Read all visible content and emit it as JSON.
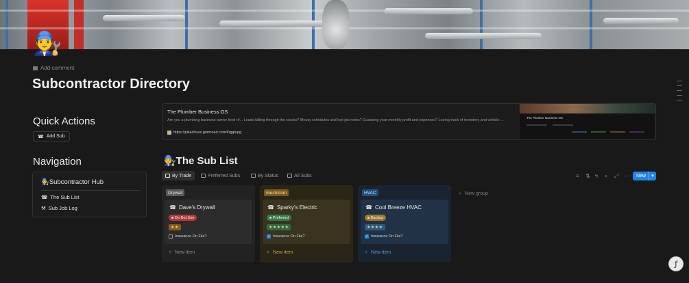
{
  "page": {
    "avatar_emoji": "🧑‍🔧",
    "add_comment": "Add comment",
    "title": "Subcontractor Directory"
  },
  "quick_actions": {
    "heading": "Quick Actions",
    "add_sub_label": "Add Sub"
  },
  "navigation": {
    "heading": "Navigation",
    "hub_title": "🧑‍🔧Subcontractor Hub",
    "links": [
      {
        "icon": "☎",
        "label": "The Sub List"
      },
      {
        "icon": "⚒",
        "label": "Sub Job Log"
      }
    ]
  },
  "bookmark": {
    "title": "The Plumber Business OS",
    "description": "Are you a plumbing business owner tired of... Leads falling through the cracks? Messy schedules and lost job notes? Guessing your monthly profit and expenses? Losing track of inventory and vehicle ...",
    "url": "https://pikachuux.gumroad.com/l/qgpupg",
    "thumb_title": "The Plumber Business OS"
  },
  "sub_list": {
    "title": "🧑‍🔧The Sub List",
    "tabs": [
      {
        "label": "By Trade",
        "active": true
      },
      {
        "label": "Preferred Subs",
        "active": false
      },
      {
        "label": "By Status",
        "active": false
      },
      {
        "label": "All Subs",
        "active": false
      }
    ],
    "new_button": "New",
    "new_group": "New group",
    "columns": [
      {
        "badge": "Drywall",
        "card_title": "Dave's Drywall",
        "status": "Do Not Use",
        "stars": "★★",
        "insurance_label": "Insurance On File?",
        "insurance_checked": false,
        "new_item": "New item"
      },
      {
        "badge": "Electrician",
        "card_title": "Sparky's Electric",
        "status": "Preferred",
        "stars": "★★★★★",
        "insurance_label": "Insurance On File?",
        "insurance_checked": true,
        "new_item": "New item"
      },
      {
        "badge": "HVAC",
        "card_title": "Cool Breeze HVAC",
        "status": "Backup",
        "stars": "★★★★",
        "insurance_label": "Insurance On File?",
        "insurance_checked": true,
        "new_item": "New item"
      }
    ]
  },
  "icons": {
    "filter": "filter-icon",
    "sort": "sort-icon",
    "automation": "lightning-icon",
    "search": "search-icon",
    "expand": "expand-icon",
    "more": "more-icon",
    "phone": "phone-icon",
    "help": "help-icon"
  },
  "colors": {
    "accent": "#2383e2",
    "background": "#191919",
    "drywall_badge": "#5a5a5a",
    "electrician_badge": "#7a5a1e",
    "hvac_badge": "#1f4f7a",
    "do_not_use": "#b23a3a",
    "preferred": "#3a7a4a",
    "backup": "#9a7a2a"
  }
}
